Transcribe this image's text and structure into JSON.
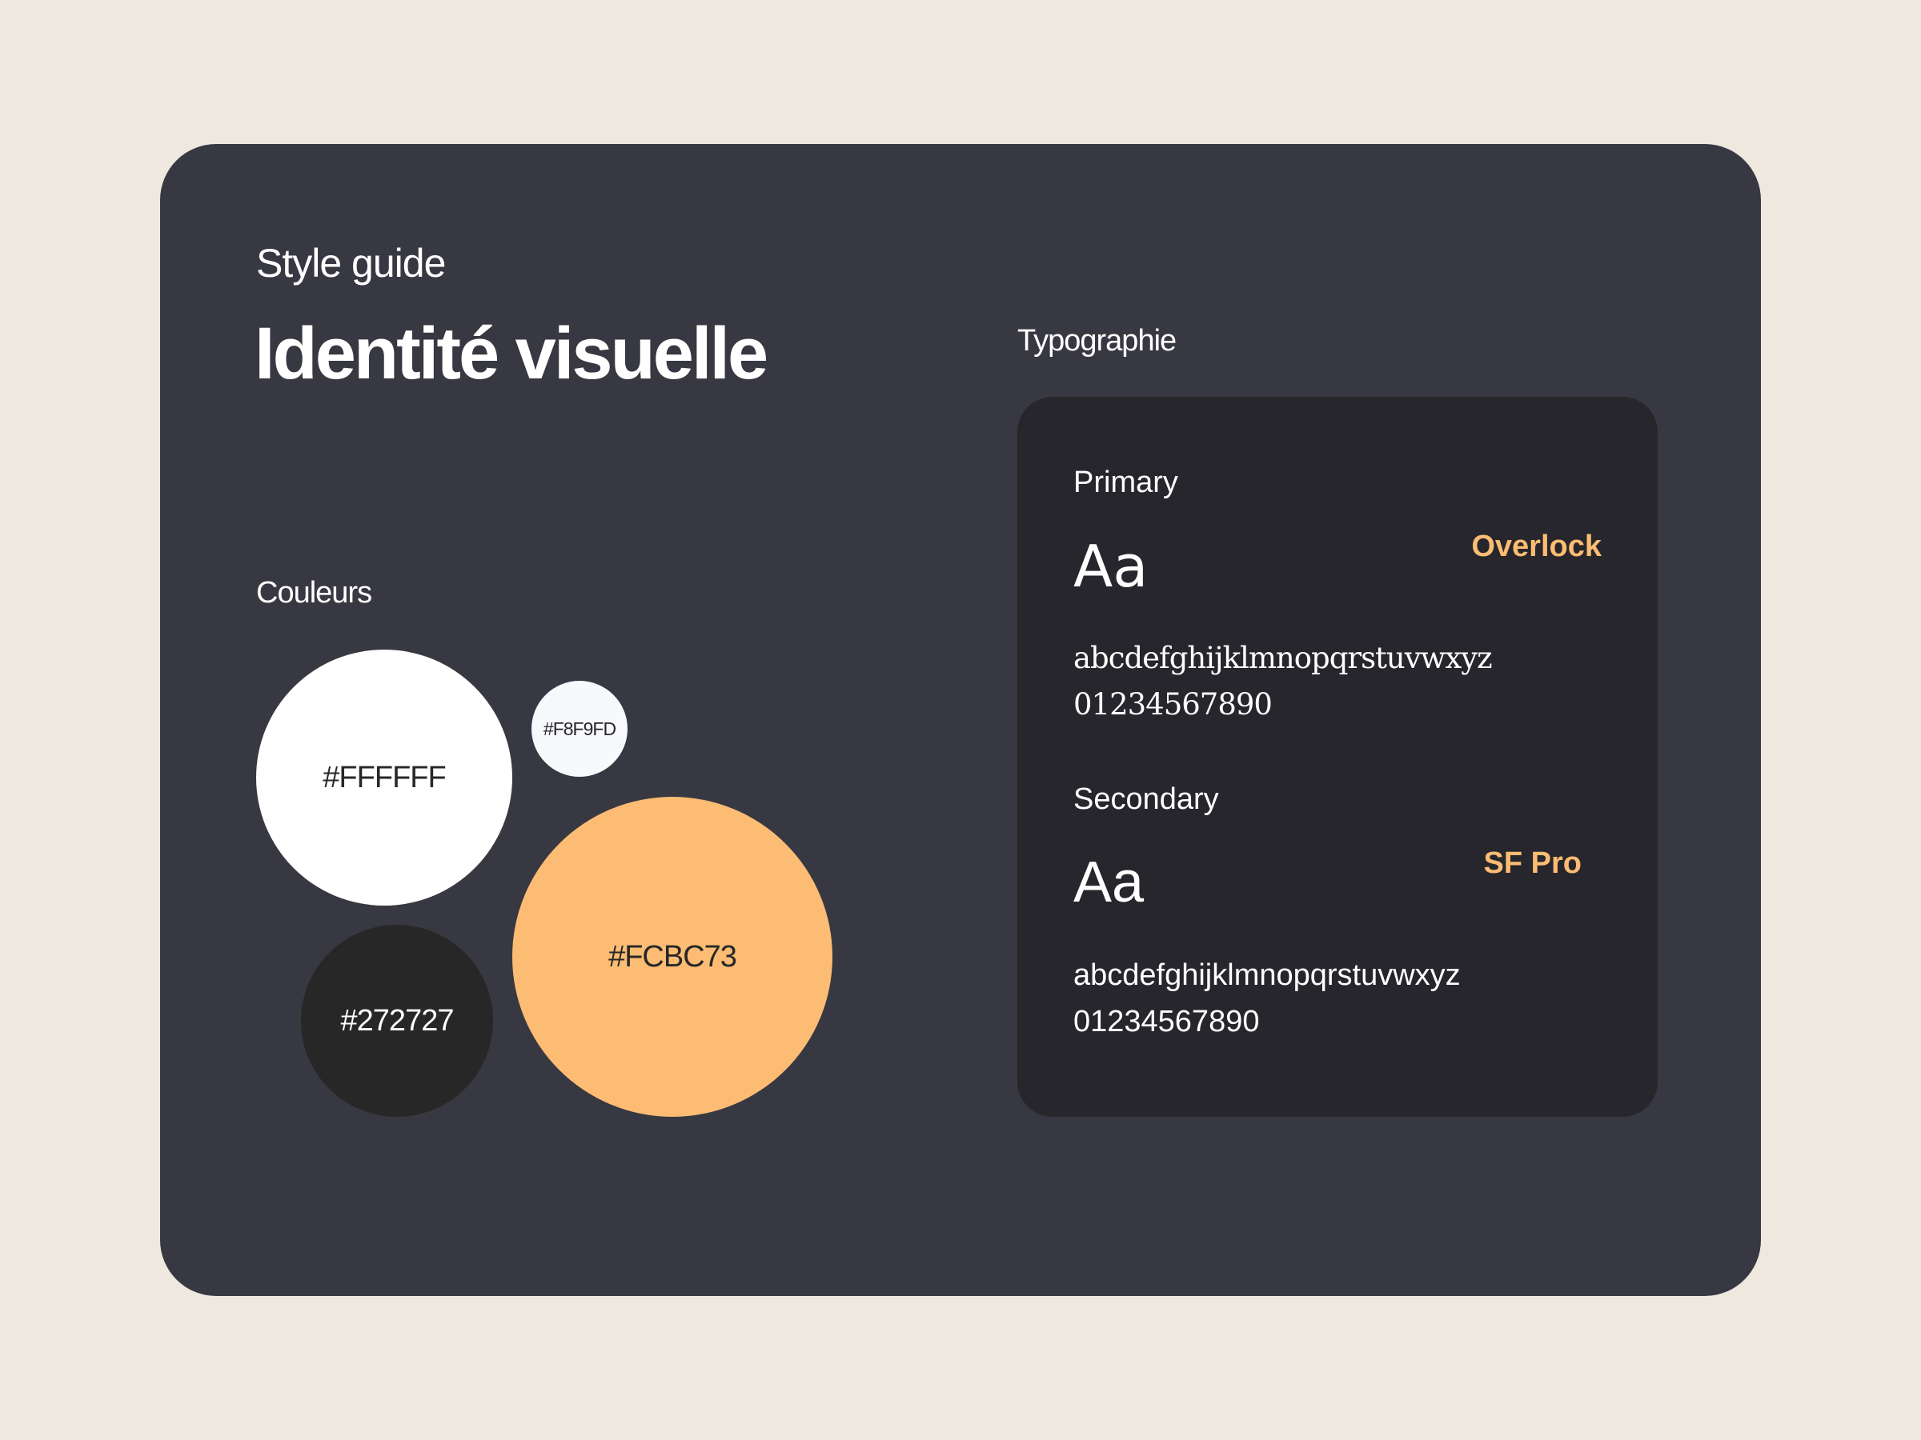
{
  "header": {
    "eyebrow": "Style guide",
    "title": "Identité visuelle"
  },
  "colors": {
    "label": "Couleurs",
    "swatches": [
      {
        "hex": "#FFFFFF",
        "label": "#FFFFFF"
      },
      {
        "hex": "#F8F9FD",
        "label": "#F8F9FD"
      },
      {
        "hex": "#272727",
        "label": "#272727"
      },
      {
        "hex": "#FCBC73",
        "label": "#FCBC73"
      }
    ]
  },
  "typography": {
    "label": "Typographie",
    "primary": {
      "role": "Primary",
      "sample": "Aa",
      "font_name": "Overlock",
      "alphabet": "abcdefghijklmnopqrstuvwxyz",
      "digits": "01234567890"
    },
    "secondary": {
      "role": "Secondary",
      "sample": "Aa",
      "font_name": "SF Pro",
      "alphabet": "abcdefghijklmnopqrstuvwxyz",
      "digits": "01234567890"
    }
  },
  "theme": {
    "background": "#EFE8DF",
    "card": "#383842",
    "typo_card": "#26262C",
    "accent": "#FCBC73"
  }
}
